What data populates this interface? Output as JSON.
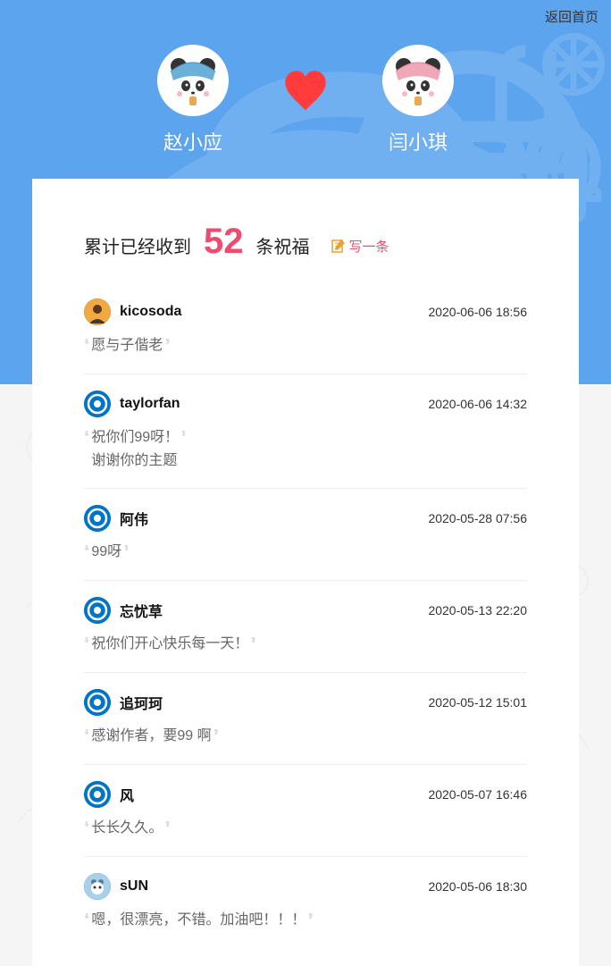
{
  "nav": {
    "back": "返回首页"
  },
  "couple": {
    "left_name": "赵小应",
    "right_name": "闫小琪"
  },
  "header": {
    "prefix": "累计已经收到",
    "count": "52",
    "suffix": "条祝福",
    "write": "写一条"
  },
  "comments": [
    {
      "name": "kicosoda",
      "time": "2020-06-06 18:56",
      "text": "愿与子偕老",
      "avatar": "orange"
    },
    {
      "name": "taylorfan",
      "time": "2020-06-06 14:32",
      "text": "祝你们99呀！\n谢谢你的主题",
      "avatar": "default"
    },
    {
      "name": "阿伟",
      "time": "2020-05-28 07:56",
      "text": "99呀",
      "avatar": "default"
    },
    {
      "name": "忘忧草",
      "time": "2020-05-13 22:20",
      "text": "祝你们开心快乐每一天！",
      "avatar": "default"
    },
    {
      "name": "追珂珂",
      "time": "2020-05-12 15:01",
      "text": "感谢作者，要99 啊",
      "avatar": "default"
    },
    {
      "name": "风",
      "time": "2020-05-07 16:46",
      "text": "长长久久。",
      "avatar": "default"
    },
    {
      "name": "sUN",
      "time": "2020-05-06 18:30",
      "text": "嗯，很漂亮，不错。加油吧！！！",
      "avatar": "blue"
    }
  ]
}
